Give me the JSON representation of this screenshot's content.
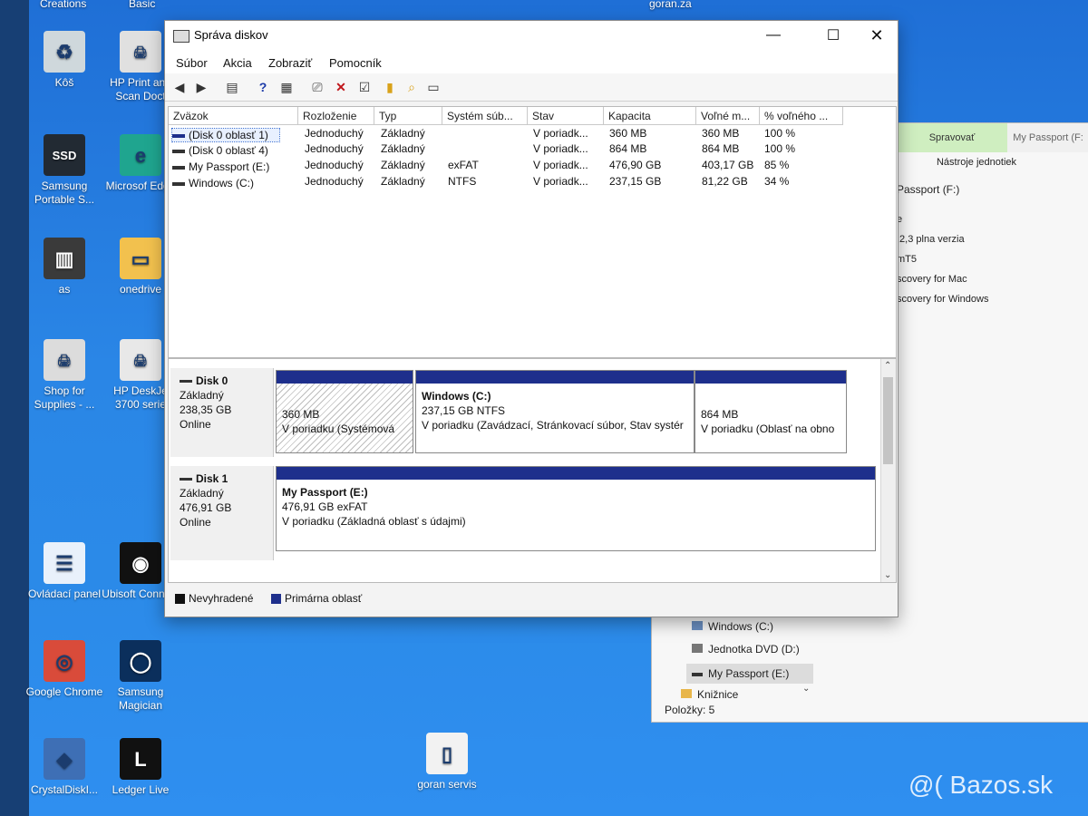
{
  "desktop": {
    "top_labels": [
      "Creations",
      "Basic",
      "goran.za"
    ],
    "icons": [
      {
        "label": "Kôš",
        "glyph": "♻",
        "color": "#cfd8dc"
      },
      {
        "label": "HP Print and Scan Doct",
        "glyph": "🖨",
        "color": "#e0e0e0"
      },
      {
        "label": "Samsung Portable S...",
        "glyph": "SSD",
        "color": "#222a33"
      },
      {
        "label": "Microsof Edge",
        "glyph": "e",
        "color": "#1fa58f"
      },
      {
        "label": "as",
        "glyph": "▥",
        "color": "#3a3a3a"
      },
      {
        "label": "onedrive",
        "glyph": "▭",
        "color": "#f2c14e"
      },
      {
        "label": "Shop for Supplies - ...",
        "glyph": "🖨",
        "color": "#dcdcdc"
      },
      {
        "label": "HP DeskJe 3700 serie",
        "glyph": "🖨",
        "color": "#e8e8e8"
      },
      {
        "label": "Ovládací panel",
        "glyph": "☰",
        "color": "#e9f1fb"
      },
      {
        "label": "Ubisoft Connect",
        "glyph": "◉",
        "color": "#111"
      },
      {
        "label": "Google Chrome",
        "glyph": "◎",
        "color": "#d94b3a"
      },
      {
        "label": "Samsung Magician",
        "glyph": "◯",
        "color": "#0b2f5c"
      },
      {
        "label": "CrystalDiskI...",
        "glyph": "◆",
        "color": "#3e6fb5"
      },
      {
        "label": "Ledger Live",
        "glyph": "L",
        "color": "#111"
      },
      {
        "label": "goran servis",
        "glyph": "▯",
        "color": "#f2f2f2"
      }
    ],
    "watermark": "@( Bazos.sk"
  },
  "explorer": {
    "ribbon_tab_manage": "Spravovať",
    "ribbon_tab_drive": "My Passport (F:",
    "ribbon_sub": "Nástroje jednotiek",
    "address": "Passport (F:)",
    "list_lines": [
      "e",
      ",2,3 plna verzia",
      "mT5",
      "scovery for Mac",
      "scovery for Windows"
    ],
    "nav_items": [
      "Windows (C:)",
      "Jednotka DVD (D:)",
      "My Passport (E:)",
      "Knižnice"
    ],
    "status": "Položky: 5"
  },
  "window": {
    "title": "Správa diskov",
    "menus": [
      "Súbor",
      "Akcia",
      "Zobraziť",
      "Pomocník"
    ],
    "toolbar_icons": [
      "back-icon",
      "forward-icon",
      "console-tree-icon",
      "help-icon",
      "properties-icon",
      "connect-icon",
      "delete-icon",
      "check-icon",
      "import-icon",
      "search-icon",
      "view-icon"
    ],
    "columns": [
      "Zväzok",
      "Rozloženie",
      "Typ",
      "Systém súb...",
      "Stav",
      "Kapacita",
      "Voľné m...",
      "% voľného ..."
    ],
    "rows": [
      [
        "(Disk 0 oblasť 1)",
        "Jednoduchý",
        "Základný",
        "",
        "V poriadk...",
        "360 MB",
        "360 MB",
        "100 %"
      ],
      [
        "(Disk 0 oblasť 4)",
        "Jednoduchý",
        "Základný",
        "",
        "V poriadk...",
        "864 MB",
        "864 MB",
        "100 %"
      ],
      [
        "My Passport (E:)",
        "Jednoduchý",
        "Základný",
        "exFAT",
        "V poriadk...",
        "476,90 GB",
        "403,17 GB",
        "85 %"
      ],
      [
        "Windows (C:)",
        "Jednoduchý",
        "Základný",
        "NTFS",
        "V poriadk...",
        "237,15 GB",
        "81,22 GB",
        "34 %"
      ]
    ],
    "disks": [
      {
        "name": "Disk 0",
        "type": "Základný",
        "size": "238,35 GB",
        "status": "Online",
        "partitions": [
          {
            "title": "",
            "line1": "360 MB",
            "line2": "V poriadku (Systémová"
          },
          {
            "title": "Windows (C:)",
            "line1": "237,15 GB NTFS",
            "line2": "V poriadku (Zavádzací, Stránkovací súbor, Stav systér"
          },
          {
            "title": "",
            "line1": "864 MB",
            "line2": "V poriadku (Oblasť na obno"
          }
        ]
      },
      {
        "name": "Disk 1",
        "type": "Základný",
        "size": "476,91 GB",
        "status": "Online",
        "partitions": [
          {
            "title": "My Passport (E:)",
            "line1": "476,91 GB exFAT",
            "line2": "V poriadku (Základná oblasť s údajmi)"
          }
        ]
      }
    ],
    "legend": [
      {
        "label": "Nevyhradené",
        "color": "#111111"
      },
      {
        "label": "Primárna oblasť",
        "color": "#1e2f8c"
      }
    ]
  }
}
